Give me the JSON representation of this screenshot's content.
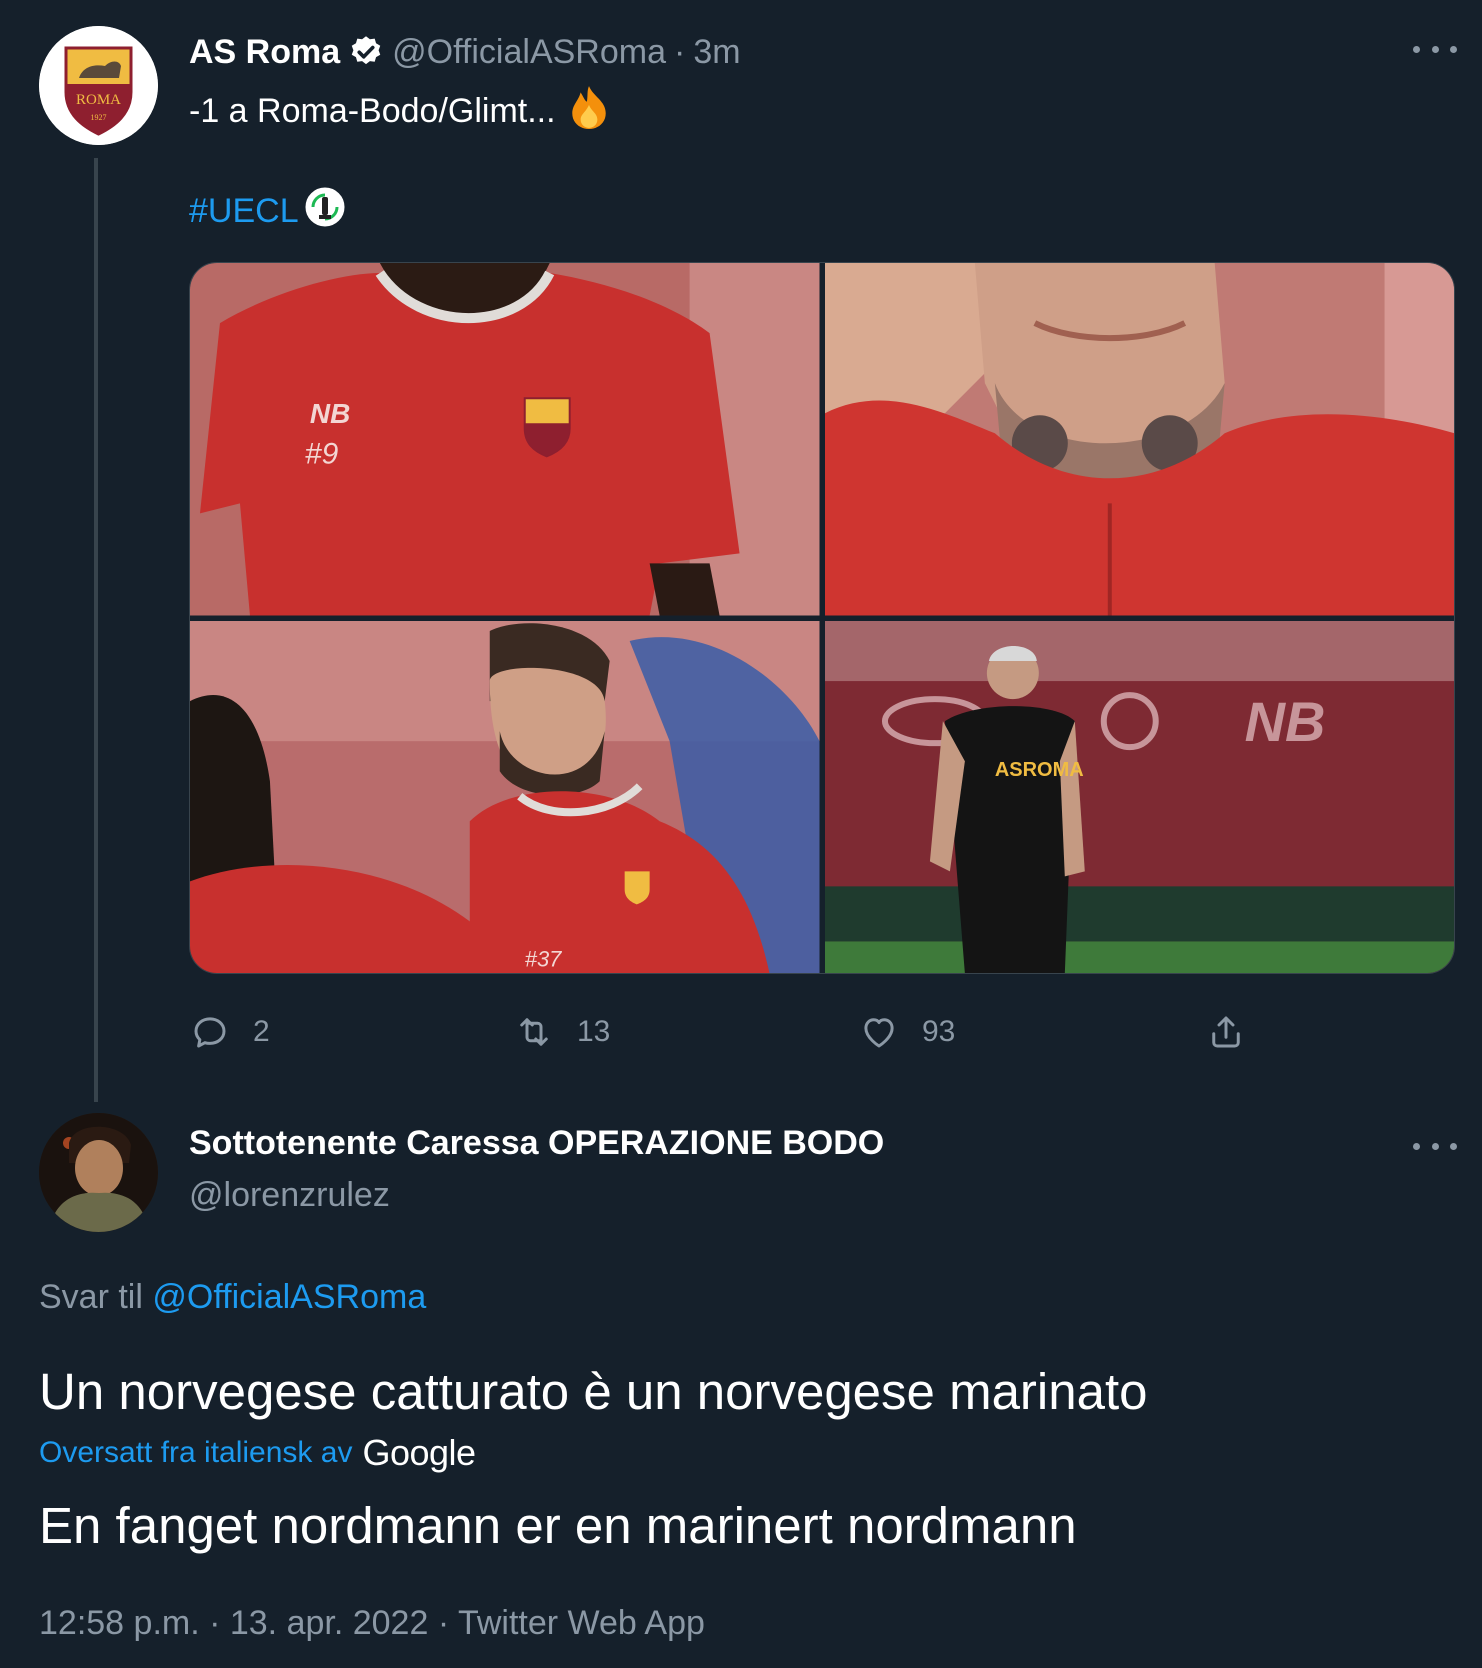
{
  "colors": {
    "background": "#15202b",
    "accent": "#1d9bf0",
    "secondary_text": "#8b98a5",
    "roma_red": "#8e1f2f",
    "roma_gold": "#f0bc42"
  },
  "tweet1": {
    "author_name": "AS Roma",
    "verified_icon": "verified-badge-icon",
    "handle": "@OfficialASRoma",
    "separator": "·",
    "time": "3m",
    "text": "-1 a Roma-Bodo/Glimt...",
    "emoji_icon": "fire-icon",
    "hashtag": "#UECL",
    "hashtag_icon": "conference-league-trophy-icon",
    "avatar_text": "ROMA",
    "avatar_year": "1927",
    "media": [
      {
        "name": "player-shirt-9",
        "shirt_number": "#9"
      },
      {
        "name": "player-neck-tattoo"
      },
      {
        "name": "player-shirt-37",
        "shirt_number": "#37"
      },
      {
        "name": "coach-training",
        "shirt_text": "ASROMA"
      }
    ],
    "actions": {
      "reply_count": "2",
      "retweet_count": "13",
      "like_count": "93"
    }
  },
  "tweet2": {
    "author_name": "Sottotenente Caressa OPERAZIONE BODO",
    "handle": "@lorenzrulez",
    "replying_label": "Svar til",
    "replying_handle": "@OfficialASRoma",
    "text": "Un norvegese catturato è un norvegese marinato",
    "translated_label": "Oversatt fra italiensk av",
    "translated_provider": "Google",
    "translation": "En fanget nordmann er en marinert nordmann",
    "meta": "12:58 p.m. · 13. apr. 2022 · Twitter Web App"
  }
}
